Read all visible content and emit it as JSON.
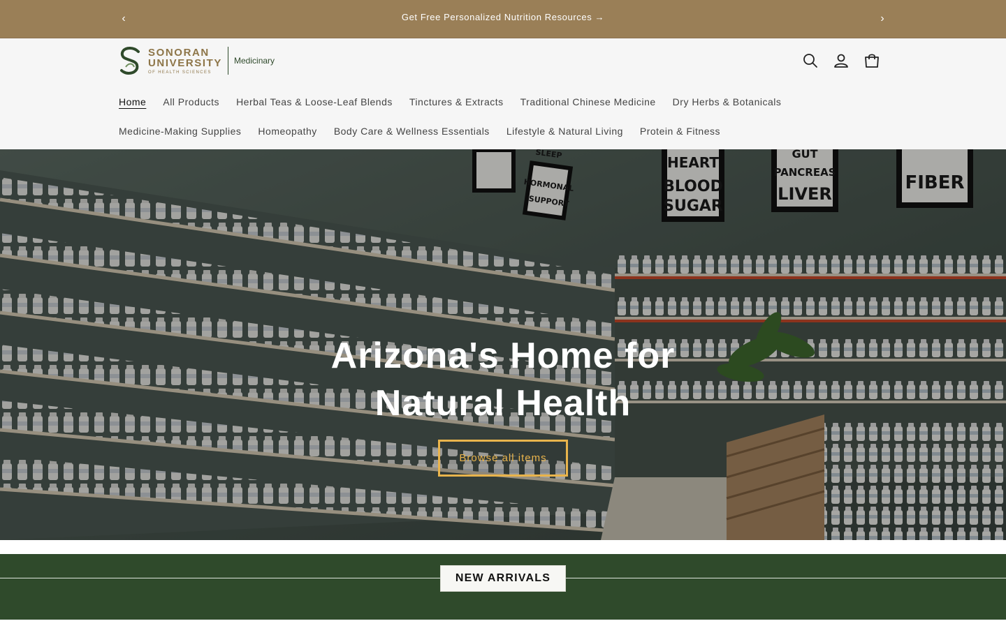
{
  "announcement": {
    "message": "Get Free Personalized Nutrition Resources",
    "arrow": "→",
    "prev_icon": "‹",
    "next_icon": "›"
  },
  "logo": {
    "line1": "SONORAN",
    "line2": "UNIVERSITY",
    "line3": "OF HEALTH SCIENCES",
    "store_name": "Medicinary"
  },
  "header_icons": [
    "search-icon",
    "account-icon",
    "cart-icon"
  ],
  "nav": {
    "row1": [
      {
        "label": "Home",
        "active": true
      },
      {
        "label": "All Products"
      },
      {
        "label": "Herbal Teas & Loose-Leaf Blends"
      },
      {
        "label": "Tinctures & Extracts"
      },
      {
        "label": "Traditional Chinese Medicine"
      },
      {
        "label": "Dry Herbs & Botanicals"
      }
    ],
    "row2": [
      {
        "label": "Medicine-Making Supplies"
      },
      {
        "label": "Homeopathy"
      },
      {
        "label": "Body Care & Wellness Essentials"
      },
      {
        "label": "Lifestyle & Natural Living"
      },
      {
        "label": "Protein & Fitness"
      }
    ]
  },
  "hero": {
    "heading_line1": "Arizona's Home for",
    "heading_line2": "Natural Health",
    "button_label": "Browse all items",
    "signs": [
      "HEART",
      "BLOOD",
      "SUGAR",
      "GUT",
      "PANCREAS",
      "LIVER",
      "FIBER",
      "HORMONAL",
      "SUPPORT",
      "SLEEP"
    ]
  },
  "new_arrivals": {
    "title": "NEW ARRIVALS"
  },
  "colors": {
    "announcement_bg": "#9a7f57",
    "header_bg": "#f6f6f6",
    "brand_green": "#2f4a2b",
    "brand_gold": "#8d7548",
    "cta_border": "#e9b44c"
  }
}
